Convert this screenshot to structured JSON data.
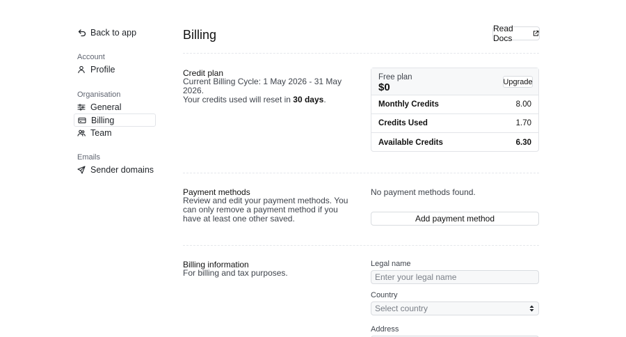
{
  "sidebar": {
    "back_label": "Back to app",
    "sections": [
      {
        "title": "Account",
        "items": [
          {
            "label": "Profile",
            "icon": "user-icon"
          }
        ]
      },
      {
        "title": "Organisation",
        "items": [
          {
            "label": "General",
            "icon": "sliders-icon"
          },
          {
            "label": "Billing",
            "icon": "credit-card-icon",
            "active": true
          },
          {
            "label": "Team",
            "icon": "users-icon"
          }
        ]
      },
      {
        "title": "Emails",
        "items": [
          {
            "label": "Sender domains",
            "icon": "send-icon"
          }
        ]
      }
    ]
  },
  "header": {
    "title": "Billing",
    "docs_label": "Read Docs"
  },
  "credit_plan": {
    "title": "Credit plan",
    "cycle_text": "Current Billing Cycle: 1 May 2026 - 31 May 2026.",
    "reset_prefix": "Your credits used will reset in ",
    "reset_days": "30 days",
    "reset_suffix": "."
  },
  "plan_card": {
    "name": "Free plan",
    "price": "$0",
    "upgrade_label": "Upgrade",
    "rows": [
      {
        "label": "Monthly Credits",
        "value": "8.00"
      },
      {
        "label": "Credits Used",
        "value": "1.70"
      },
      {
        "label": "Available Credits",
        "value": "6.30"
      }
    ]
  },
  "payment": {
    "title": "Payment methods",
    "description": "Review and edit your payment methods. You can only remove a payment method if you have at least one other saved.",
    "empty_text": "No payment methods found.",
    "add_label": "Add payment method"
  },
  "billing_info": {
    "title": "Billing information",
    "description": "For billing and tax purposes.",
    "legal_name_label": "Legal name",
    "legal_name_placeholder": "Enter your legal name",
    "legal_name_value": "",
    "country_label": "Country",
    "country_placeholder": "Select country",
    "address_label": "Address"
  }
}
